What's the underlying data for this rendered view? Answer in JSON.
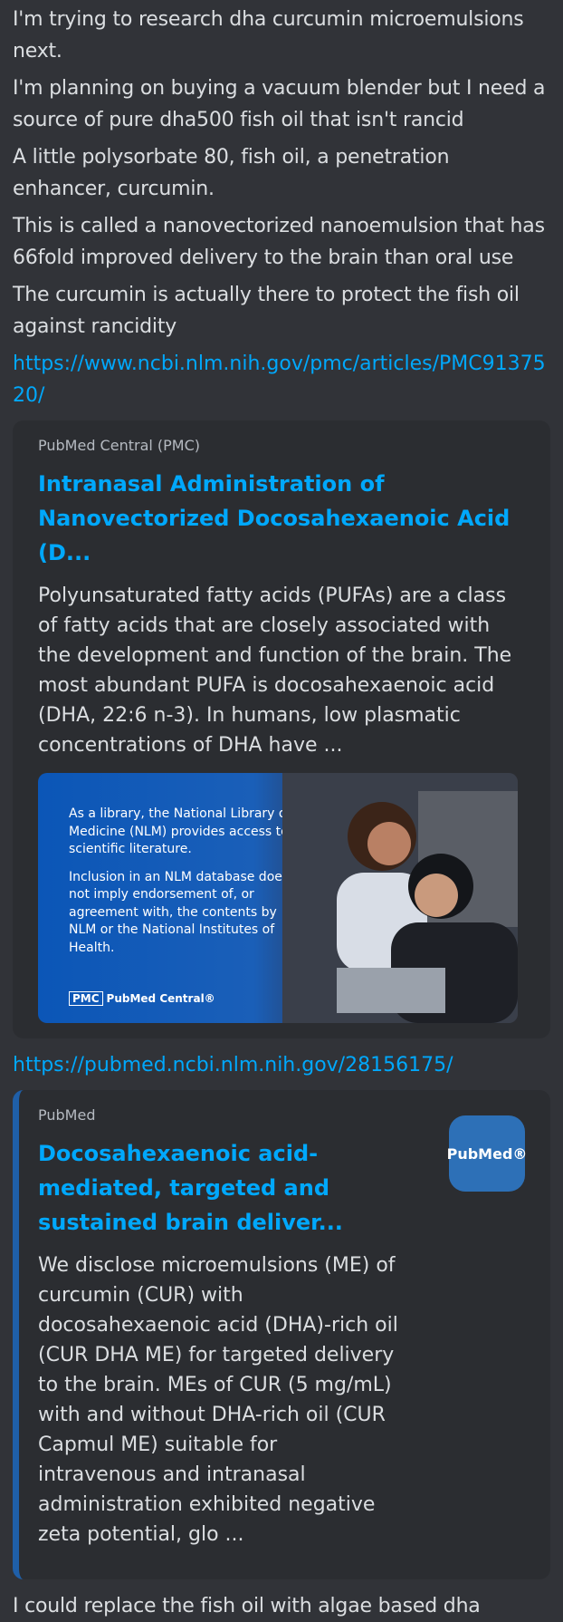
{
  "messages": {
    "m1": "I'm trying to research dha curcumin microemulsions next.",
    "m2": "I'm planning on buying a vacuum blender but I need a source of pure dha500 fish oil that isn't rancid",
    "m3": "A little polysorbate 80, fish oil, a penetration enhancer, curcumin.",
    "m4": "This is called a nanovectorized nanoemulsion that has 66fold improved delivery to the brain than oral use",
    "m5": "The curcumin is actually there to protect the fish oil against rancidity",
    "link1": "https://www.ncbi.nlm.nih.gov/pmc/articles/PMC9137520/",
    "link2": "https://pubmed.ncbi.nlm.nih.gov/28156175/",
    "m6": "I could replace the fish oil with algae based dha"
  },
  "embed1": {
    "provider": "PubMed Central (PMC)",
    "title": "Intranasal Administration of Nanovectorized Docosahexaenoic Acid (D...",
    "description": "Polyunsaturated fatty acids (PUFAs) are a class of fatty acids that are closely associated with the development and function of the brain. The most abundant PUFA is docosahexaenoic acid (DHA, 22:6 n-3). In humans, low plasmatic concentrations of DHA have ...",
    "image_text_1": "As a library, the National Library of Medicine (NLM) provides access to scientific literature.",
    "image_text_2": "Inclusion in an NLM database does not imply endorsement of, or agreement with, the contents by NLM or the National Institutes of Health.",
    "logo_box": "PMC",
    "logo_text": "PubMed Central®"
  },
  "embed2": {
    "provider": "PubMed",
    "title": "Docosahexaenoic acid-mediated, targeted and sustained brain deliver...",
    "description": "We disclose microemulsions (ME) of curcumin (CUR) with docosahexaenoic acid (DHA)-rich oil (CUR DHA ME) for targeted delivery to the brain. MEs of CUR (5 mg/mL) with and without DHA-rich oil (CUR Capmul ME) suitable for intravenous and intranasal administration exhibited negative zeta potential, glo ...",
    "thumb_text": "PubMed®"
  },
  "colors": {
    "background": "#313338",
    "embed_bg": "#2b2d31",
    "link": "#00a8fc",
    "text": "#dbdee1"
  }
}
